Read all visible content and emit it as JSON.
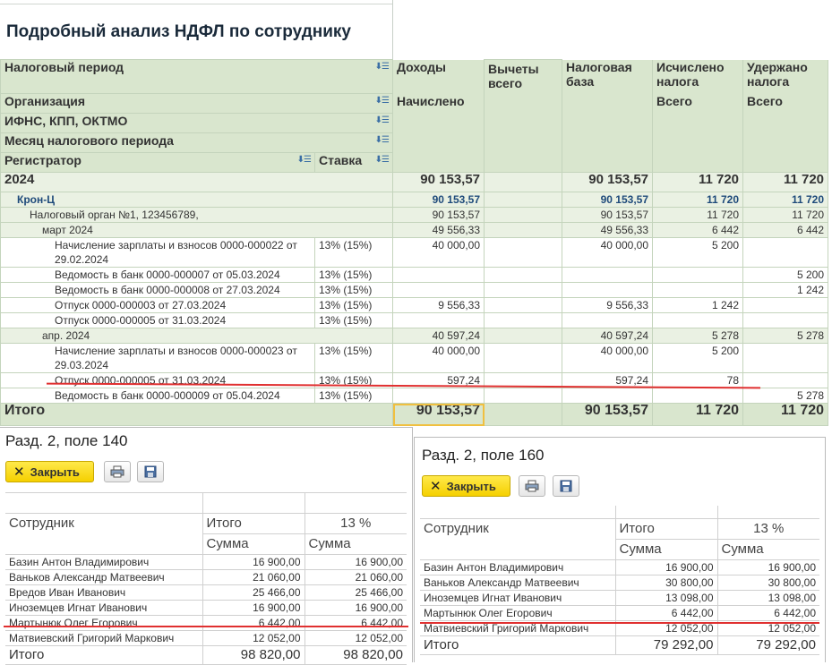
{
  "report": {
    "title": "Подробный анализ НДФЛ по сотруднику",
    "headers": {
      "tax_period": "Налоговый период",
      "organization": "Организация",
      "ifns": "ИФНС, КПП, ОКТМО",
      "month": "Месяц налогового периода",
      "registrar": "Регистратор",
      "rate": "Ставка",
      "income": "Доходы",
      "accrued": "Начислено",
      "deductions": "Вычеты всего",
      "tax_base": "Налоговая база",
      "calculated": "Исчислено налога",
      "withheld": "Удержано налога",
      "total_sub": "Всего"
    },
    "rows": {
      "year": {
        "label": "2024",
        "income": "90 153,57",
        "base": "90 153,57",
        "calc": "11 720",
        "withheld": "11 720"
      },
      "org": {
        "label": "Крон-Ц",
        "income": "90 153,57",
        "base": "90 153,57",
        "calc": "11 720",
        "withheld": "11 720"
      },
      "ifns": {
        "label": "Налоговый орган №1, 123456789,",
        "income": "90 153,57",
        "base": "90 153,57",
        "calc": "11 720",
        "withheld": "11 720"
      },
      "march": {
        "label": "март 2024",
        "income": "49 556,33",
        "base": "49 556,33",
        "calc": "6 442",
        "withheld": "6 442"
      },
      "r1": {
        "label": "Начисление зарплаты и взносов 0000-000022 от 29.02.2024",
        "rate": "13% (15%)",
        "income": "40 000,00",
        "base": "40 000,00",
        "calc": "5 200",
        "withheld": ""
      },
      "r2": {
        "label": "Ведомость в банк 0000-000007 от 05.03.2024",
        "rate": "13% (15%)",
        "income": "",
        "base": "",
        "calc": "",
        "withheld": "5 200"
      },
      "r3": {
        "label": "Ведомость в банк 0000-000008 от 27.03.2024",
        "rate": "13% (15%)",
        "income": "",
        "base": "",
        "calc": "",
        "withheld": "1 242"
      },
      "r4": {
        "label": "Отпуск 0000-000003 от 27.03.2024",
        "rate": "13% (15%)",
        "income": "9 556,33",
        "base": "9 556,33",
        "calc": "1 242",
        "withheld": ""
      },
      "r5": {
        "label": "Отпуск 0000-000005 от 31.03.2024",
        "rate": "13% (15%)",
        "income": "",
        "base": "",
        "calc": "",
        "withheld": ""
      },
      "april": {
        "label": "апр. 2024",
        "income": "40 597,24",
        "base": "40 597,24",
        "calc": "5 278",
        "withheld": "5 278"
      },
      "r6": {
        "label": "Начисление зарплаты и взносов 0000-000023 от 29.03.2024",
        "rate": "13% (15%)",
        "income": "40 000,00",
        "base": "40 000,00",
        "calc": "5 200",
        "withheld": ""
      },
      "r7": {
        "label": "Отпуск 0000-000005 от 31.03.2024",
        "rate": "13% (15%)",
        "income": "597,24",
        "base": "597,24",
        "calc": "78",
        "withheld": ""
      },
      "r8": {
        "label": "Ведомость в банк 0000-000009 от 05.04.2024",
        "rate": "13% (15%)",
        "income": "",
        "base": "",
        "calc": "",
        "withheld": "5 278"
      },
      "total": {
        "label": "Итого",
        "income": "90 153,57",
        "base": "90 153,57",
        "calc": "11 720",
        "withheld": "11 720"
      }
    }
  },
  "panel140": {
    "title": "Разд. 2, поле 140",
    "close_label": "Закрыть",
    "col_employee": "Сотрудник",
    "col_total": "Итого",
    "col_rate": "13 %",
    "col_sum": "Сумма",
    "rows": [
      {
        "name": "Базин Антон Владимирович",
        "total": "16 900,00",
        "rate": "16 900,00"
      },
      {
        "name": "Ваньков Александр Матвеевич",
        "total": "21 060,00",
        "rate": "21 060,00"
      },
      {
        "name": "Вредов Иван Иванович",
        "total": "25 466,00",
        "rate": "25 466,00"
      },
      {
        "name": "Иноземцев Игнат Иванович",
        "total": "16 900,00",
        "rate": "16 900,00"
      },
      {
        "name": "Мартынюк Олег Егорович",
        "total": "6 442,00",
        "rate": "6 442,00"
      },
      {
        "name": "Матвиевский Григорий Маркович",
        "total": "12 052,00",
        "rate": "12 052,00"
      }
    ],
    "total_label": "Итого",
    "total_value": "98 820,00",
    "total_rate": "98 820,00"
  },
  "panel160": {
    "title": "Разд. 2, поле 160",
    "close_label": "Закрыть",
    "col_employee": "Сотрудник",
    "col_total": "Итого",
    "col_rate": "13 %",
    "col_sum": "Сумма",
    "rows": [
      {
        "name": "Базин Антон Владимирович",
        "total": "16 900,00",
        "rate": "16 900,00"
      },
      {
        "name": "Ваньков Александр Матвеевич",
        "total": "30 800,00",
        "rate": "30 800,00"
      },
      {
        "name": "Иноземцев Игнат Иванович",
        "total": "13 098,00",
        "rate": "13 098,00"
      },
      {
        "name": "Мартынюк Олег Егорович",
        "total": "6 442,00",
        "rate": "6 442,00"
      },
      {
        "name": "Матвиевский Григорий Маркович",
        "total": "12 052,00",
        "rate": "12 052,00"
      }
    ],
    "total_label": "Итого",
    "total_value": "79 292,00",
    "total_rate": "79 292,00"
  },
  "colors": {
    "header_bg": "#d9e6ce",
    "group_bg": "#eaf1e3",
    "close_button": "#f5d000",
    "annotation_line": "#e03030"
  }
}
